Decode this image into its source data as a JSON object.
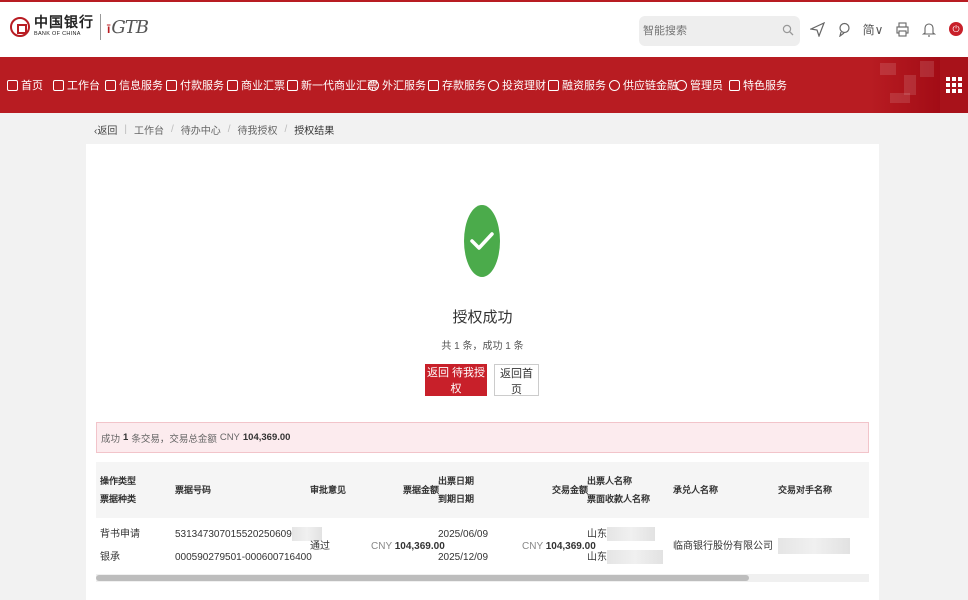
{
  "header": {
    "logo_cn": "中国银行",
    "logo_en": "BANK OF CHINA",
    "product_mark": "GTB",
    "search_placeholder": "智能搜索",
    "lang": "简∨"
  },
  "nav": {
    "items": [
      {
        "label": "首页"
      },
      {
        "label": "工作台"
      },
      {
        "label": "信息服务"
      },
      {
        "label": "付款服务"
      },
      {
        "label": "商业汇票"
      },
      {
        "label": "新一代商业汇票"
      },
      {
        "label": "外汇服务"
      },
      {
        "label": "存款服务"
      },
      {
        "label": "投资理财"
      },
      {
        "label": "融资服务"
      },
      {
        "label": "供应链金融"
      },
      {
        "label": "管理员"
      },
      {
        "label": "特色服务"
      }
    ]
  },
  "breadcrumb": {
    "back": "返回",
    "items": [
      "工作台",
      "待办中心",
      "待我授权",
      "授权结果"
    ]
  },
  "result": {
    "title": "授权成功",
    "summary": "共 1 条，成功 1 条",
    "btn_back_pending": "返回 待我授权",
    "btn_home": "返回首页",
    "bar_prefix": "成功",
    "bar_count": "1",
    "bar_mid": "条交易，交易总金额",
    "bar_currency": "CNY",
    "bar_amount": "104,369.00"
  },
  "table": {
    "headers": {
      "op_type": "操作类型",
      "bill_kind": "票据种类",
      "bill_no": "票据号码",
      "opinion": "审批意见",
      "bill_amount": "票据金额",
      "issue_date": "出票日期",
      "due_date": "到期日期",
      "trade_amount": "交易金额",
      "drawer": "出票人名称",
      "payee": "票面收款人名称",
      "acceptor": "承兑人名称",
      "counterparty": "交易对手名称"
    },
    "row": {
      "op_type": "背书申请",
      "bill_kind": "银承",
      "bill_no_1": "5313473070155202506​09",
      "bill_no_2": "000590279501-000600716400",
      "opinion": "通过",
      "bill_currency": "CNY",
      "bill_amount": "104,369.00",
      "issue_date": "2025/06/09",
      "due_date": "2025/12/09",
      "trade_currency": "CNY",
      "trade_amount": "104,369.00",
      "drawer_prefix": "山东",
      "payee_prefix": "山东",
      "acceptor": "临商银行股份有限公司"
    }
  },
  "colors": {
    "brand_red": "#b81c22",
    "success_green": "#4bab4b"
  }
}
